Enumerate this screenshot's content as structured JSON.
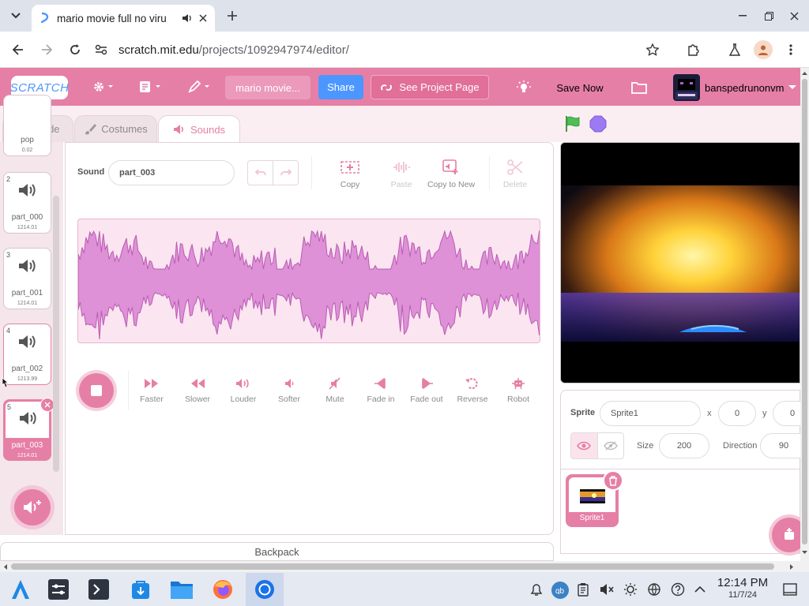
{
  "browser": {
    "tab_title": "mario movie full no viru",
    "url_host": "scratch.mit.edu",
    "url_path": "/projects/1092947974/editor/"
  },
  "menubar": {
    "logo": "SCRATCH",
    "project_title": "mario movie...",
    "share_label": "Share",
    "see_project_label": "See Project Page",
    "save_now_label": "Save Now",
    "username": "banspedrunonvm",
    "accent_color": "#e67fa5"
  },
  "editor_tabs": [
    "Code",
    "Costumes",
    "Sounds"
  ],
  "sound_list": [
    {
      "num": "",
      "name": "pop",
      "duration": "0.02"
    },
    {
      "num": "2",
      "name": "part_000",
      "duration": "1214.01"
    },
    {
      "num": "3",
      "name": "part_001",
      "duration": "1214.01"
    },
    {
      "num": "4",
      "name": "part_002",
      "duration": "1213.99"
    },
    {
      "num": "5",
      "name": "part_003",
      "duration": "1214.01"
    }
  ],
  "sound_editor": {
    "sound_label": "Sound",
    "sound_name": "part_003",
    "tools": [
      "Copy",
      "Paste",
      "Copy to New",
      "Delete"
    ],
    "effects": [
      "Faster",
      "Slower",
      "Louder",
      "Softer",
      "Mute",
      "Fade in",
      "Fade out",
      "Reverse",
      "Robot"
    ]
  },
  "backpack_label": "Backpack",
  "sprite_panel": {
    "sprite_label": "Sprite",
    "sprite_name": "Sprite1",
    "x_label": "x",
    "x_value": "0",
    "y_label": "y",
    "y_value": "0",
    "size_label": "Size",
    "size_value": "200",
    "direction_label": "Direction",
    "direction_value": "90",
    "sprite_thumb_name": "Sprite1"
  },
  "taskbar": {
    "time": "12:14 PM",
    "date": "11/7/24"
  }
}
